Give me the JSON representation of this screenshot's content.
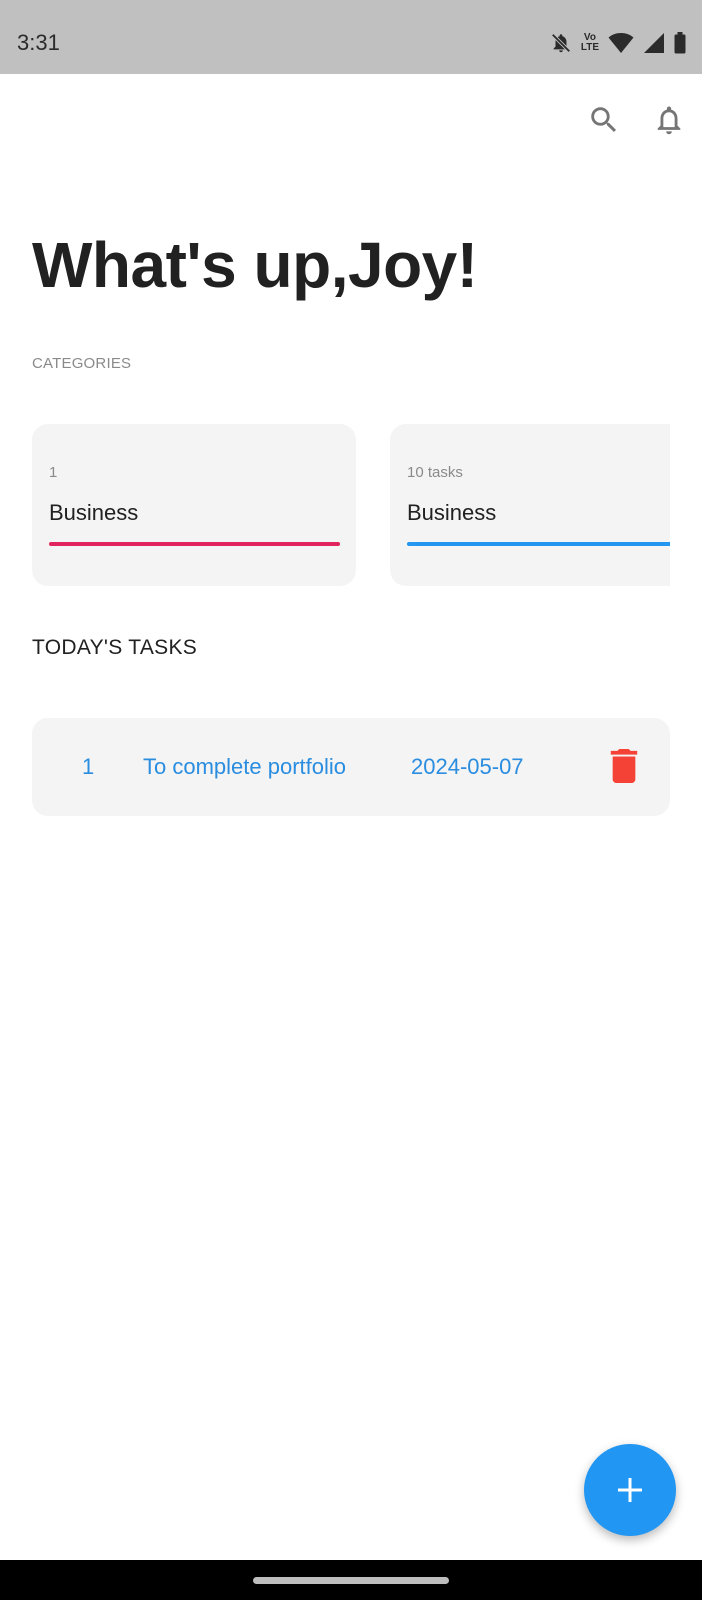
{
  "status_bar": {
    "time": "3:31",
    "lte_top": "Vo",
    "lte_bottom": "LTE",
    "icons": [
      "notifications-off-icon",
      "volte-icon",
      "wifi-icon",
      "signal-icon",
      "battery-icon"
    ]
  },
  "app_bar": {
    "icons": [
      "search-icon",
      "bell-icon"
    ]
  },
  "greeting": "What's up,Joy!",
  "categories": {
    "label": "CATEGORIES",
    "items": [
      {
        "count": "1",
        "name": "Business",
        "color": "#e0245e"
      },
      {
        "count": "10 tasks",
        "name": "Business",
        "color": "#2196f3"
      }
    ]
  },
  "today": {
    "label": "TODAY'S TASKS",
    "tasks": [
      {
        "number": "1",
        "title": "To complete portfolio",
        "date": "2024-05-07"
      }
    ]
  },
  "fab": {
    "icon": "plus-icon"
  },
  "colors": {
    "accent": "#2196f3",
    "task_text": "#2a8de0",
    "delete": "#f44336",
    "card_bg": "#f4f4f4",
    "status_bar": "#c0c0c0"
  }
}
